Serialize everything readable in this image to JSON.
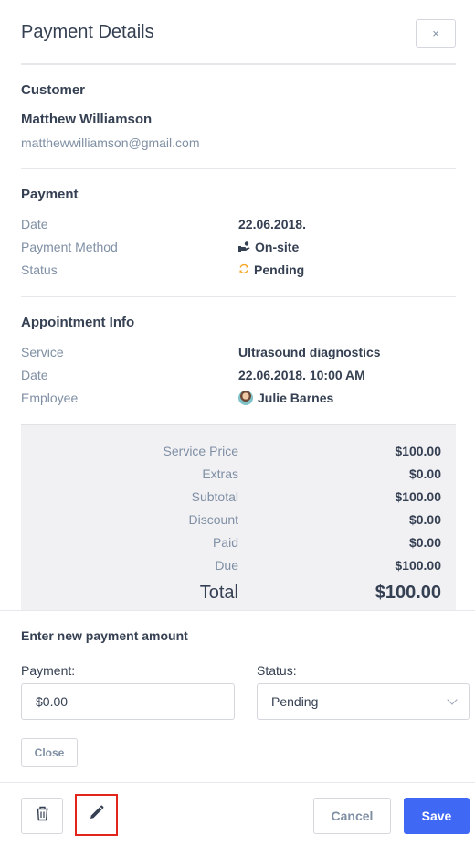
{
  "header": {
    "title": "Payment Details",
    "close_icon": "×"
  },
  "customer": {
    "section_title": "Customer",
    "name": "Matthew Williamson",
    "email": "matthewwilliamson@gmail.com"
  },
  "payment": {
    "section_title": "Payment",
    "rows": [
      {
        "label": "Date",
        "value": "22.06.2018."
      },
      {
        "label": "Payment Method",
        "value": "On-site",
        "icon": "hand-cash-icon"
      },
      {
        "label": "Status",
        "value": "Pending",
        "icon": "refresh-pending-icon"
      }
    ]
  },
  "appointment": {
    "section_title": "Appointment Info",
    "rows": [
      {
        "label": "Service",
        "value": "Ultrasound diagnostics"
      },
      {
        "label": "Date",
        "value": "22.06.2018. 10:00 AM"
      },
      {
        "label": "Employee",
        "value": "Julie Barnes",
        "icon": "avatar"
      }
    ]
  },
  "totals": {
    "rows": [
      {
        "label": "Service Price",
        "value": "$100.00"
      },
      {
        "label": "Extras",
        "value": "$0.00"
      },
      {
        "label": "Subtotal",
        "value": "$100.00"
      },
      {
        "label": "Discount",
        "value": "$0.00"
      },
      {
        "label": "Paid",
        "value": "$0.00"
      },
      {
        "label": "Due",
        "value": "$100.00"
      }
    ],
    "total_label": "Total",
    "total_value": "$100.00"
  },
  "new_payment": {
    "title": "Enter new payment amount",
    "payment_label": "Payment:",
    "payment_value": "$0.00",
    "status_label": "Status:",
    "status_value": "Pending",
    "close_label": "Close"
  },
  "footer": {
    "delete_icon": "trash-icon",
    "edit_icon": "pencil-icon",
    "cancel_label": "Cancel",
    "save_label": "Save"
  },
  "colors": {
    "accent": "#3f68f5",
    "pending": "#f5a623",
    "highlight": "#e3241b"
  }
}
